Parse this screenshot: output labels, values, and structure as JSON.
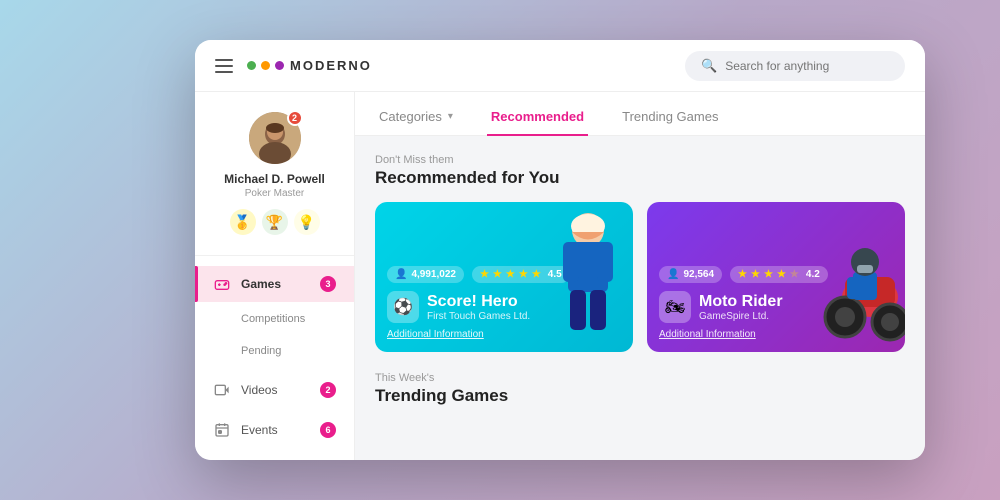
{
  "app": {
    "title": "MODERNO",
    "logo_dots": [
      {
        "color": "#4caf50"
      },
      {
        "color": "#ff9800"
      },
      {
        "color": "#9c27b0"
      }
    ]
  },
  "search": {
    "placeholder": "Search for anything"
  },
  "user": {
    "name": "Michael D. Powell",
    "title": "Poker Master",
    "badge_count": "2",
    "achievements": [
      "🥇",
      "🏆",
      "💡"
    ]
  },
  "nav": {
    "items": [
      {
        "id": "games",
        "label": "Games",
        "badge": "3",
        "active": true
      },
      {
        "id": "competitions",
        "label": "Competitions",
        "sub": true
      },
      {
        "id": "pending",
        "label": "Pending",
        "sub": true
      },
      {
        "id": "videos",
        "label": "Videos",
        "badge": "2"
      },
      {
        "id": "events",
        "label": "Events",
        "badge": "6"
      }
    ]
  },
  "tabs": [
    {
      "label": "Categories",
      "has_chevron": true
    },
    {
      "label": "Recommended",
      "active": true
    },
    {
      "label": "Trending Games"
    }
  ],
  "recommended_section": {
    "subtitle": "Don't Miss them",
    "title": "Recommended for You"
  },
  "games": [
    {
      "id": "score-hero",
      "title": "Score! Hero",
      "publisher": "First Touch Games Ltd.",
      "players": "4,991,022",
      "rating": "4.5",
      "stars": 4.5,
      "card_color": "cyan",
      "additional_label": "Additional Information"
    },
    {
      "id": "moto-rider",
      "title": "Moto Rider",
      "publisher": "GameSpire Ltd.",
      "players": "92,564",
      "rating": "4.2",
      "stars": 4,
      "card_color": "purple",
      "additional_label": "Additional Information"
    }
  ],
  "trending_section": {
    "subtitle": "This Week's",
    "title": "Trending Games"
  }
}
